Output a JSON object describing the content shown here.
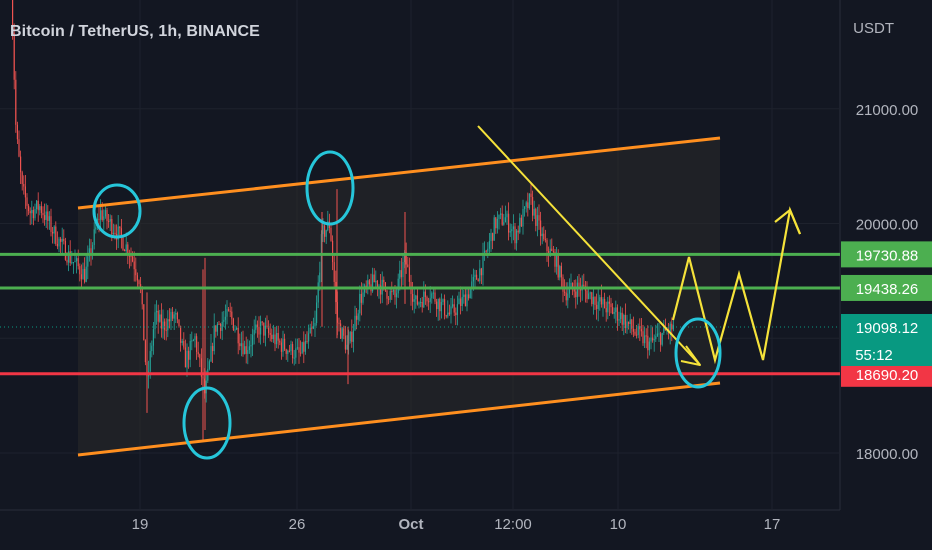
{
  "header": {
    "title": "Bitcoin / TetherUS, 1h, BINANCE",
    "unit": "USDT"
  },
  "chart_data": {
    "type": "line",
    "symbol": "Bitcoin / TetherUS",
    "interval": "1h",
    "exchange": "BINANCE",
    "ylim": [
      17900,
      22300
    ],
    "y_ticks": [
      {
        "value": 21000,
        "label": "21000.00"
      },
      {
        "value": 20000,
        "label": "20000.00"
      },
      {
        "value": 18000,
        "label": "18000.00"
      }
    ],
    "x_ticks": [
      {
        "label": "19",
        "bold": false
      },
      {
        "label": "26",
        "bold": false
      },
      {
        "label": "Oct",
        "bold": true
      },
      {
        "label": "12:00",
        "bold": false
      },
      {
        "label": "10",
        "bold": false
      },
      {
        "label": "17",
        "bold": false
      }
    ],
    "levels": [
      {
        "value": 19730.88,
        "label": "19730.88",
        "color": "#4caf50"
      },
      {
        "value": 19438.26,
        "label": "19438.26",
        "color": "#4caf50"
      },
      {
        "value": 18690.2,
        "label": "18690.20",
        "color": "#f23645"
      }
    ],
    "last_price": {
      "value": 19098.12,
      "label": "19098.12",
      "countdown": "55:12",
      "color": "#089981"
    },
    "channel_color": "#ff8f1f",
    "projection_color": "#f5e23a",
    "circle_color": "#26c6da",
    "candle_up": "#26a69a",
    "candle_down": "#ef5350"
  }
}
